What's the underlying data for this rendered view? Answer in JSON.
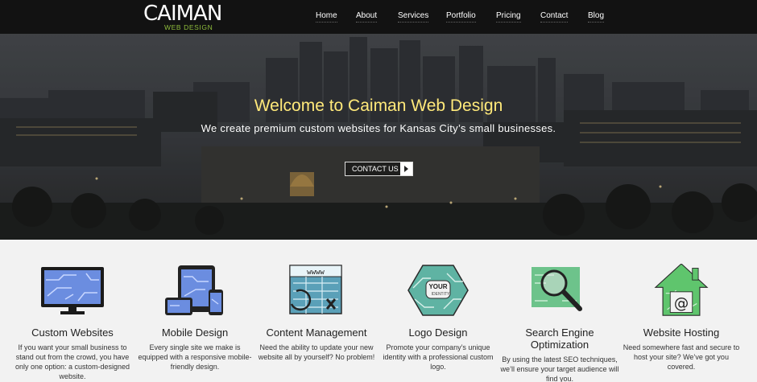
{
  "header": {
    "logo_text": "CAIMAN",
    "logo_sub": "WEB DESIGN",
    "nav": [
      "Home",
      "About",
      "Services",
      "Portfolio",
      "Pricing",
      "Contact",
      "Blog"
    ]
  },
  "hero": {
    "title": "Welcome to Caiman Web Design",
    "subtitle": "We create premium custom websites for Kansas City’s small businesses.",
    "cta_label": "CONTACT US"
  },
  "services": [
    {
      "title": "Custom Websites",
      "desc": "If you want your small business to stand out from the crowd, you have only one option: a custom-designed website.",
      "icon": "monitor-icon"
    },
    {
      "title": "Mobile Design",
      "desc": "Every single site we make is equipped with a responsive mobile-friendly design.",
      "icon": "devices-icon"
    },
    {
      "title": "Content Management",
      "desc": "Need the ability to update your new website all by yourself? No problem!",
      "icon": "cms-icon"
    },
    {
      "title": "Logo Design",
      "desc": "Promote your company’s unique identity with a professional custom logo.",
      "icon": "logo-badge-icon"
    },
    {
      "title": "Search Engine Optimization",
      "desc": "By using the latest SEO techniques, we’ll ensure your target audience will find you.",
      "icon": "magnifier-icon"
    },
    {
      "title": "Website Hosting",
      "desc": "Need somewhere fast and secure to host your site? We’ve got you covered.",
      "icon": "house-at-icon"
    }
  ],
  "icon_text": {
    "logo_badge_line1": "YOUR",
    "logo_badge_line2": "IDENTITY",
    "cms_top": "wwww"
  },
  "colors": {
    "accent_green": "#8fbd3c",
    "hero_title": "#ffe97a",
    "topbar": "#121212",
    "icon_blue": "#5b7fd6",
    "icon_teal": "#3e8c8c",
    "icon_green": "#59c46b"
  }
}
